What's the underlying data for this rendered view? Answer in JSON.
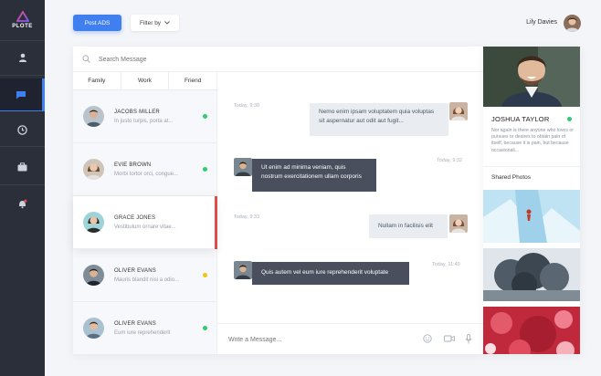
{
  "app": {
    "logo_text": "PLOTE"
  },
  "colors": {
    "accent": "#3f7ff0",
    "online": "#2ecc71",
    "away": "#f1c40f",
    "active_marker": "#e04b4b",
    "rail_bg": "#2b2f3a"
  },
  "rail": [
    {
      "name": "user-icon"
    },
    {
      "name": "chat-icon"
    },
    {
      "name": "clock-icon"
    },
    {
      "name": "briefcase-icon"
    },
    {
      "name": "bell-icon"
    }
  ],
  "toolbar": {
    "post_label": "Post ADS",
    "filter_label": "Filter by"
  },
  "user": {
    "name": "Lily Davies"
  },
  "search": {
    "placeholder": "Search Message"
  },
  "tabs": [
    {
      "label": "Family"
    },
    {
      "label": "Work"
    },
    {
      "label": "Friend"
    }
  ],
  "contacts": [
    {
      "name": "JACOBS MILLER",
      "preview": "In justo turpis, porta at...",
      "status": "online"
    },
    {
      "name": "EVIE BROWN",
      "preview": "Morbi tortor orci, congue...",
      "status": "online"
    },
    {
      "name": "GRACE JONES",
      "preview": "Vestibulum ornare vitae...",
      "status": "none"
    },
    {
      "name": "OLIVER EVANS",
      "preview": "Mauris blandit nisi a odio...",
      "status": "away"
    },
    {
      "name": "OLIVER EVANS",
      "preview": "Eum iure reprehenderit",
      "status": "online"
    }
  ],
  "messages": [
    {
      "time": "Today, 9:30",
      "direction": "incoming",
      "text": "Nemo enim ipsam voluptatem quia voluptas sit aspernatur aut odit aut fugit..."
    },
    {
      "time": "Today, 9:32",
      "direction": "outgoing",
      "text": "Ut enim ad minima veniam, quis nostrum exercitationem ullam corporis"
    },
    {
      "time": "Today, 9:33",
      "direction": "incoming",
      "text": "Nullam in facilisis elit"
    },
    {
      "time": "Today, 11:49",
      "direction": "outgoing",
      "text": "Quis autem vel eum iure reprehenderit voluptate"
    }
  ],
  "compose": {
    "placeholder": "Write a Message..."
  },
  "profile": {
    "name": "JOSHUA TAYLOR",
    "status": "online",
    "bio": "Nor again is there anyone who loves or pursues or desires to obtain pain of itself, because it is pain, but because occasionall...",
    "shared_label": "Shared Photos"
  }
}
